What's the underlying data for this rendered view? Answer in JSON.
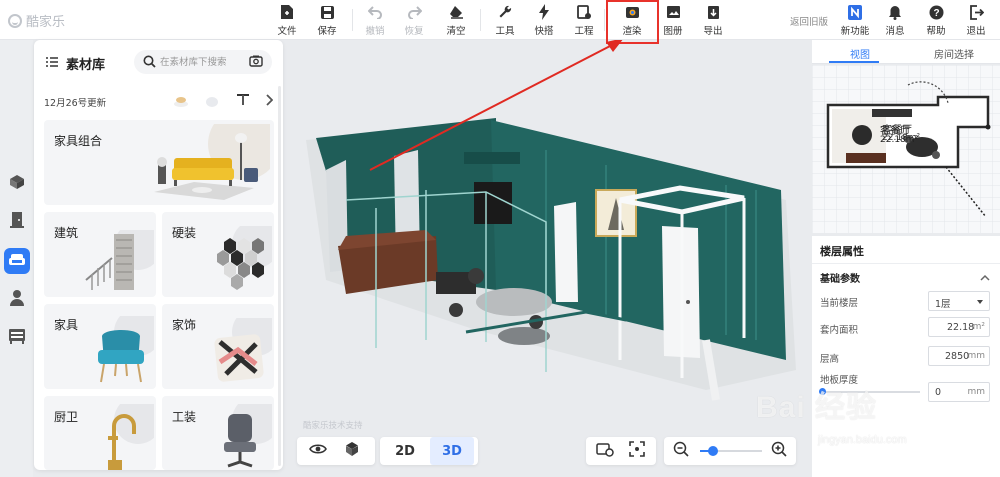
{
  "app": {
    "logo_text": "酷家乐"
  },
  "toolbar": {
    "items": [
      {
        "label": "文件",
        "icon": "file-icon"
      },
      {
        "label": "保存",
        "icon": "save-icon"
      },
      {
        "label": "撤销",
        "icon": "undo-icon",
        "disabled": true
      },
      {
        "label": "恢复",
        "icon": "redo-icon",
        "disabled": true
      },
      {
        "label": "清空",
        "icon": "eraser-icon"
      },
      {
        "label": "工具",
        "icon": "wrench-icon"
      },
      {
        "label": "快搭",
        "icon": "lightning-icon"
      },
      {
        "label": "工程",
        "icon": "project-icon"
      },
      {
        "label": "渲染",
        "icon": "render-camera-icon",
        "highlighted": true
      },
      {
        "label": "图册",
        "icon": "album-icon"
      },
      {
        "label": "导出",
        "icon": "export-icon"
      }
    ],
    "old_version_link": "返回旧版",
    "right_items": [
      {
        "label": "新功能",
        "icon": "new-feature-icon"
      },
      {
        "label": "消息",
        "icon": "bell-icon"
      },
      {
        "label": "帮助",
        "icon": "help-icon"
      },
      {
        "label": "退出",
        "icon": "exit-icon"
      }
    ]
  },
  "library": {
    "title": "素材库",
    "search_placeholder": "在素材库下搜索",
    "update_text": "12月26号更新",
    "categories": [
      {
        "label": "家具组合"
      },
      {
        "label": "建筑"
      },
      {
        "label": "硬装"
      },
      {
        "label": "家具"
      },
      {
        "label": "家饰"
      },
      {
        "label": "厨卫"
      },
      {
        "label": "工装"
      }
    ]
  },
  "viewport": {
    "room_label": "客餐厅",
    "room_area": "22.18m²",
    "watermark": "酷家乐技术支持",
    "view_2d": "2D",
    "view_3d": "3D",
    "active_view": "3D"
  },
  "minimap": {
    "tabs": [
      "视图",
      "房间选择"
    ],
    "active_tab": "视图",
    "room_label": "客餐厅",
    "room_area": "22.18m²"
  },
  "properties": {
    "title": "楼层属性",
    "section": "基础参数",
    "floor_label": "当前楼层",
    "floor_value": "1层",
    "area_label": "套内面积",
    "area_value": "22.18",
    "area_unit": "m²",
    "height_label": "层高",
    "height_value": "2850",
    "height_unit": "mm",
    "floor_thickness_label": "地板厚度",
    "floor_thickness_value": "0",
    "floor_thickness_unit": "mm"
  },
  "overlay": {
    "baidu_watermark": "Bai 经验",
    "baidu_url": "jingyan.baidu.com"
  },
  "colors": {
    "accent": "#2f7bf5",
    "highlight_box": "#e8322b",
    "wall_green": "#1f5d58"
  }
}
